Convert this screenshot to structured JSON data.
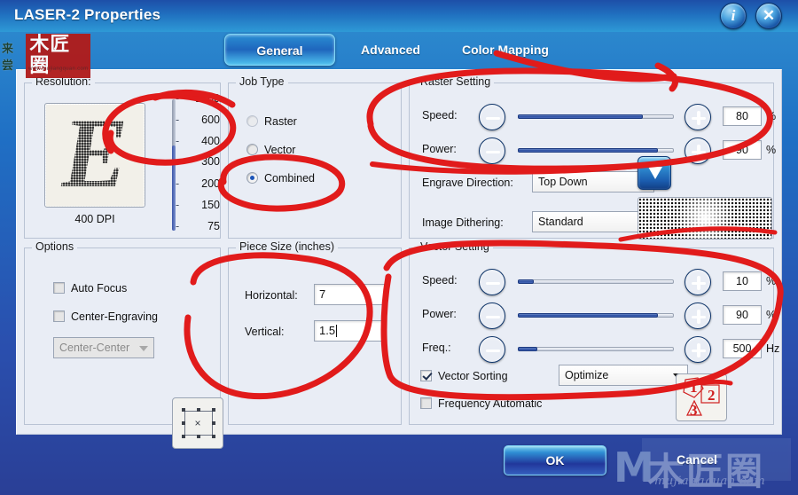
{
  "window": {
    "title": "LASER-2 Properties",
    "info_icon": "info-icon",
    "close_icon": "close-icon"
  },
  "tabs": [
    {
      "label": "General",
      "active": true
    },
    {
      "label": "Advanced",
      "active": false
    },
    {
      "label": "Color Mapping",
      "active": false
    }
  ],
  "resolution": {
    "group_title": "Resolution:",
    "preview_glyph": "E",
    "dpi_label": "400 DPI",
    "ticks": [
      "1200",
      "600",
      "400",
      "300",
      "200",
      "150",
      "75"
    ],
    "selected": "400"
  },
  "job_type": {
    "group_title": "Job Type",
    "options": [
      {
        "label": "Raster",
        "selected": false
      },
      {
        "label": "Vector",
        "selected": false
      },
      {
        "label": "Combined",
        "selected": true
      }
    ]
  },
  "raster": {
    "group_title": "Raster Setting",
    "speed_label": "Speed:",
    "speed_value": "80",
    "speed_unit": "%",
    "speed_percent": 80,
    "power_label": "Power:",
    "power_value": "90",
    "power_unit": "%",
    "power_percent": 90,
    "engrave_direction_label": "Engrave Direction:",
    "engrave_direction_value": "Top Down",
    "image_dithering_label": "Image Dithering:",
    "image_dithering_value": "Standard"
  },
  "options": {
    "group_title": "Options",
    "auto_focus_label": "Auto Focus",
    "auto_focus_checked": false,
    "center_engraving_label": "Center-Engraving",
    "center_engraving_checked": false,
    "center_position_value": "Center-Center",
    "center_position_disabled": true
  },
  "piece_size": {
    "group_title": "Piece Size (inches)",
    "horizontal_label": "Horizontal:",
    "horizontal_value": "7",
    "vertical_label": "Vertical:",
    "vertical_value": "1.5"
  },
  "vector": {
    "group_title": "Vector Setting",
    "speed_label": "Speed:",
    "speed_value": "10",
    "speed_unit": "%",
    "speed_percent": 10,
    "power_label": "Power:",
    "power_value": "90",
    "power_unit": "%",
    "power_percent": 90,
    "freq_label": "Freq.:",
    "freq_value": "500",
    "freq_unit": "Hz",
    "freq_percent": 12,
    "vector_sorting_label": "Vector Sorting",
    "vector_sorting_checked": true,
    "vector_sorting_mode": "Optimize",
    "frequency_automatic_label": "Frequency Automatic",
    "frequency_automatic_checked": false,
    "sort_icon_numbers": [
      "1",
      "2",
      "3"
    ]
  },
  "footer": {
    "ok_label": "OK",
    "cancel_label": "Cancel"
  },
  "watermarks": {
    "top_left_cn": "来尝",
    "top_left_mark": "木匠圈",
    "top_left_url": "www.mujiangquan.com",
    "bottom_letter": "M",
    "bottom_cn": "木匠圈",
    "bottom_domain": "mujiangquan.com"
  },
  "colors": {
    "title_bar": "#2070bf",
    "panel_bg": "#e9edf5",
    "accent_blue": "#1d55b8",
    "annotation_red": "#e11b1b",
    "slider_fill": "#2a4c9e"
  }
}
